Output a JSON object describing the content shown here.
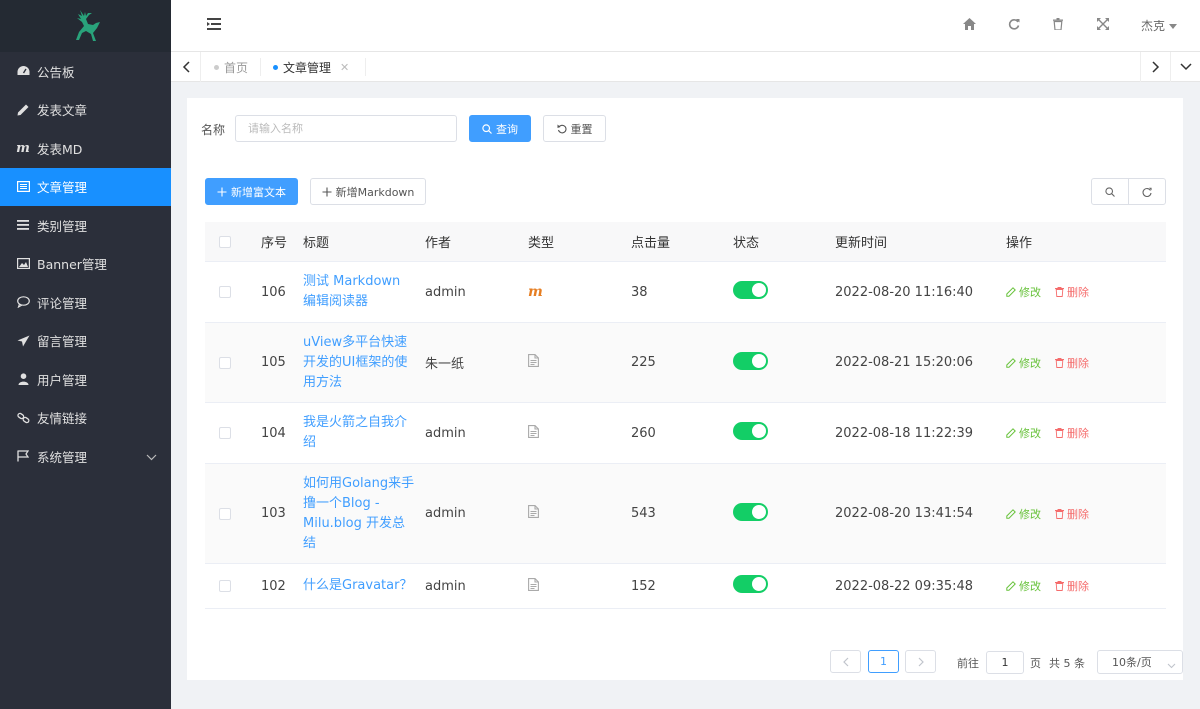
{
  "colors": {
    "sidebar_bg": "#2b2f3a",
    "active": "#1890ff",
    "primary": "#409eff",
    "switch_on": "#13ce66",
    "edit": "#67c23a",
    "delete": "#f56c6c",
    "logo": "#29a37b"
  },
  "sidebar": {
    "logo_icon": "deer-logo",
    "items": [
      {
        "label": "公告板",
        "icon": "dashboard-icon"
      },
      {
        "label": "发表文章",
        "icon": "pencil-icon"
      },
      {
        "label": "发表MD",
        "icon": "markdown-icon"
      },
      {
        "label": "文章管理",
        "icon": "list-box-icon",
        "active": true
      },
      {
        "label": "类别管理",
        "icon": "menu-lines-icon"
      },
      {
        "label": "Banner管理",
        "icon": "image-icon"
      },
      {
        "label": "评论管理",
        "icon": "comment-icon"
      },
      {
        "label": "留言管理",
        "icon": "send-icon"
      },
      {
        "label": "用户管理",
        "icon": "user-icon"
      },
      {
        "label": "友情链接",
        "icon": "link-icon"
      },
      {
        "label": "系统管理",
        "icon": "flag-icon",
        "expandable": true
      }
    ]
  },
  "header": {
    "user": "杰克"
  },
  "tabs": [
    {
      "label": "首页",
      "active": false
    },
    {
      "label": "文章管理",
      "active": true,
      "closable": true
    }
  ],
  "search": {
    "label": "名称",
    "placeholder": "请输入名称",
    "value": "",
    "query_label": "查询",
    "reset_label": "重置"
  },
  "toolbar": {
    "add_rich_label": "新增富文本",
    "add_md_label": "新增Markdown"
  },
  "table": {
    "headers": {
      "seq": "序号",
      "title": "标题",
      "author": "作者",
      "type": "类型",
      "hits": "点击量",
      "status": "状态",
      "updated": "更新时间",
      "ops": "操作"
    },
    "edit_label": "修改",
    "delete_label": "删除",
    "rows": [
      {
        "seq": "106",
        "title": "测试 Markdown 编辑阅读器",
        "author": "admin",
        "type": "markdown",
        "hits": "38",
        "status": true,
        "updated": "2022-08-20 11:16:40"
      },
      {
        "seq": "105",
        "title": "uView多平台快速开发的UI框架的使用方法",
        "author": "朱一纸",
        "type": "richtext",
        "hits": "225",
        "status": true,
        "updated": "2022-08-21 15:20:06"
      },
      {
        "seq": "104",
        "title": "我是火箭之自我介绍",
        "author": "admin",
        "type": "richtext",
        "hits": "260",
        "status": true,
        "updated": "2022-08-18 11:22:39"
      },
      {
        "seq": "103",
        "title": "如何用Golang来手撸一个Blog - Milu.blog 开发总结",
        "author": "admin",
        "type": "richtext",
        "hits": "543",
        "status": true,
        "updated": "2022-08-20 13:41:54"
      },
      {
        "seq": "102",
        "title": "什么是Gravatar？",
        "author": "admin",
        "type": "richtext",
        "hits": "152",
        "status": true,
        "updated": "2022-08-22 09:35:48"
      }
    ]
  },
  "pagination": {
    "current_page": "1",
    "goto_label": "前往",
    "goto_value": "1",
    "page_label": "页",
    "total_label": "共 5 条",
    "page_size": "10条/页"
  }
}
